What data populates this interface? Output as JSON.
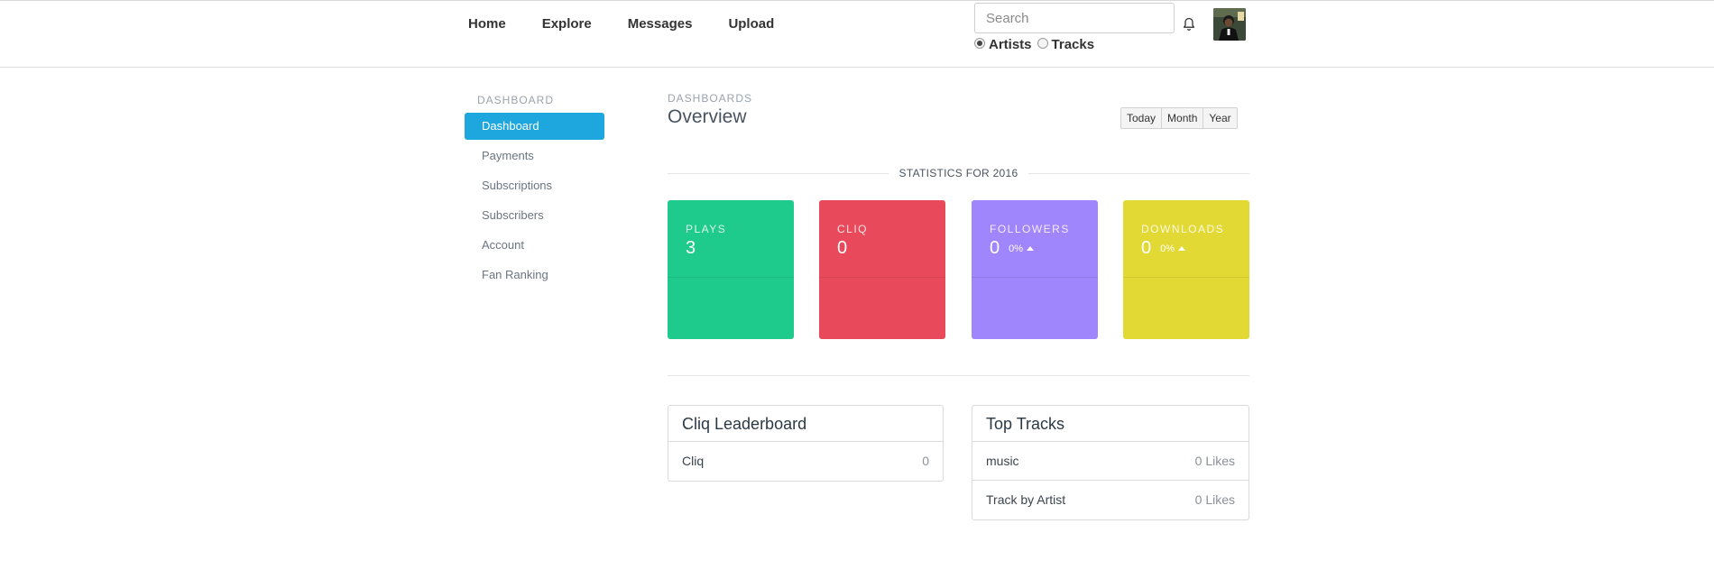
{
  "nav": [
    "Home",
    "Explore",
    "Messages",
    "Upload"
  ],
  "search": {
    "placeholder": "Search",
    "options": [
      {
        "label": "Artists",
        "checked": true
      },
      {
        "label": "Tracks",
        "checked": false
      }
    ]
  },
  "icons": {
    "bell": "bell-icon",
    "avatar": "user-avatar"
  },
  "sidebar": {
    "title": "DASHBOARD",
    "items": [
      "Dashboard",
      "Payments",
      "Subscriptions",
      "Subscribers",
      "Account",
      "Fan Ranking"
    ],
    "active": "Dashboard"
  },
  "main": {
    "breadcrumb": "DASHBOARDS",
    "title": "Overview",
    "ranges": [
      "Today",
      "Month",
      "Year"
    ],
    "stats_heading": "STATISTICS FOR 2016",
    "tiles": [
      {
        "label": "PLAYS",
        "value": "3",
        "pct": "",
        "color": "#1ecb8c"
      },
      {
        "label": "CLIQ",
        "value": "0",
        "pct": "",
        "color": "#e84a5b"
      },
      {
        "label": "FOLLOWERS",
        "value": "0",
        "pct": "0%",
        "color": "#9f86fc"
      },
      {
        "label": "DOWNLOADS",
        "value": "0",
        "pct": "0%",
        "color": "#e2d934"
      }
    ]
  },
  "leaderboard": {
    "title": "Cliq Leaderboard",
    "rows": [
      {
        "name": "Cliq",
        "value": "0"
      }
    ]
  },
  "top_tracks": {
    "title": "Top Tracks",
    "rows": [
      {
        "name": "music",
        "value": "0 Likes"
      },
      {
        "name": "Track by Artist",
        "value": "0 Likes"
      }
    ]
  },
  "colors": {
    "accent": "#1ea7de"
  }
}
